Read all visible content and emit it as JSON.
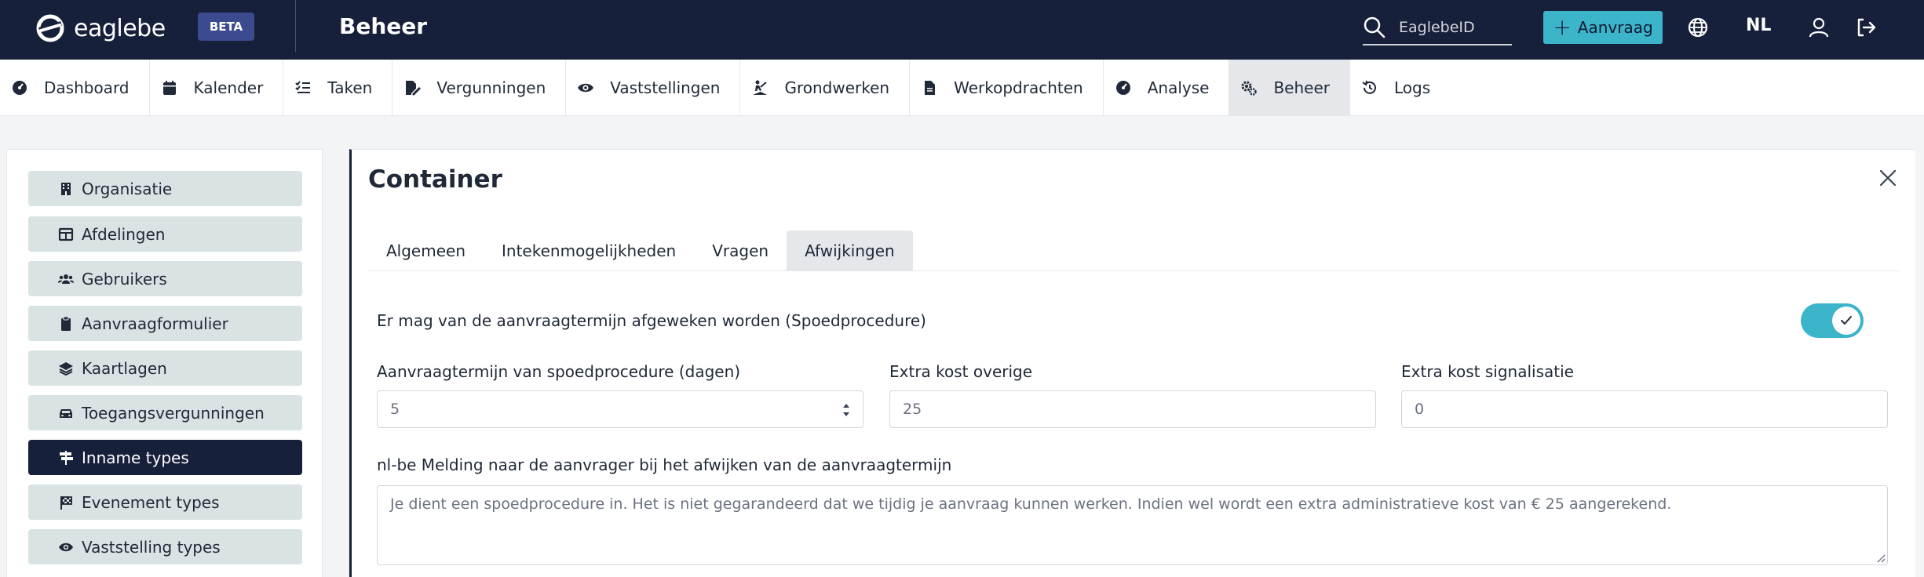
{
  "header": {
    "logo_text": "eaglebe",
    "beta_label": "BETA",
    "title": "Beheer",
    "search_placeholder": "EaglebeID",
    "new_request_label": "Aanvraag",
    "language": "NL",
    "colors": {
      "bar": "#17203a",
      "accent": "#3cb4c9"
    }
  },
  "nav": {
    "items": [
      {
        "label": "Dashboard",
        "icon": "gauge-icon"
      },
      {
        "label": "Kalender",
        "icon": "calendar-icon"
      },
      {
        "label": "Taken",
        "icon": "tasks-icon"
      },
      {
        "label": "Vergunningen",
        "icon": "file-signature-icon"
      },
      {
        "label": "Vaststellingen",
        "icon": "eye-icon"
      },
      {
        "label": "Grondwerken",
        "icon": "digging-icon"
      },
      {
        "label": "Werkopdrachten",
        "icon": "file-icon"
      },
      {
        "label": "Analyse",
        "icon": "gauge-icon"
      },
      {
        "label": "Beheer",
        "icon": "cogs-icon",
        "active": true
      },
      {
        "label": "Logs",
        "icon": "history-icon"
      }
    ]
  },
  "sidebar": {
    "items": [
      {
        "label": "Organisatie",
        "icon": "building-icon"
      },
      {
        "label": "Afdelingen",
        "icon": "table-icon"
      },
      {
        "label": "Gebruikers",
        "icon": "users-icon"
      },
      {
        "label": "Aanvraagformulier",
        "icon": "clipboard-icon"
      },
      {
        "label": "Kaartlagen",
        "icon": "layers-icon"
      },
      {
        "label": "Toegangsvergunningen",
        "icon": "car-icon"
      },
      {
        "label": "Inname types",
        "icon": "signs-icon",
        "active": true
      },
      {
        "label": "Evenement types",
        "icon": "flag-icon"
      },
      {
        "label": "Vaststelling types",
        "icon": "eye-icon"
      }
    ]
  },
  "panel": {
    "title": "Container",
    "tabs": [
      {
        "label": "Algemeen"
      },
      {
        "label": "Intekenmogelijkheden"
      },
      {
        "label": "Vragen"
      },
      {
        "label": "Afwijkingen",
        "active": true
      }
    ],
    "toggle": {
      "label": "Er mag van de aanvraagtermijn afgeweken worden (Spoedprocedure)",
      "on": true
    },
    "fields": [
      {
        "label": "Aanvraagtermijn van spoedprocedure (dagen)",
        "value": "5"
      },
      {
        "label": "Extra kost overige",
        "value": "25"
      },
      {
        "label": "Extra kost signalisatie",
        "value": "0"
      }
    ],
    "message": {
      "label": "nl-be Melding naar de aanvrager bij het afwijken van de aanvraagtermijn",
      "value": "Je dient een spoedprocedure in. Het is niet gegarandeerd dat we tijdig je aanvraag kunnen werken. Indien wel wordt een extra administratieve kost van € 25 aangerekend."
    }
  }
}
